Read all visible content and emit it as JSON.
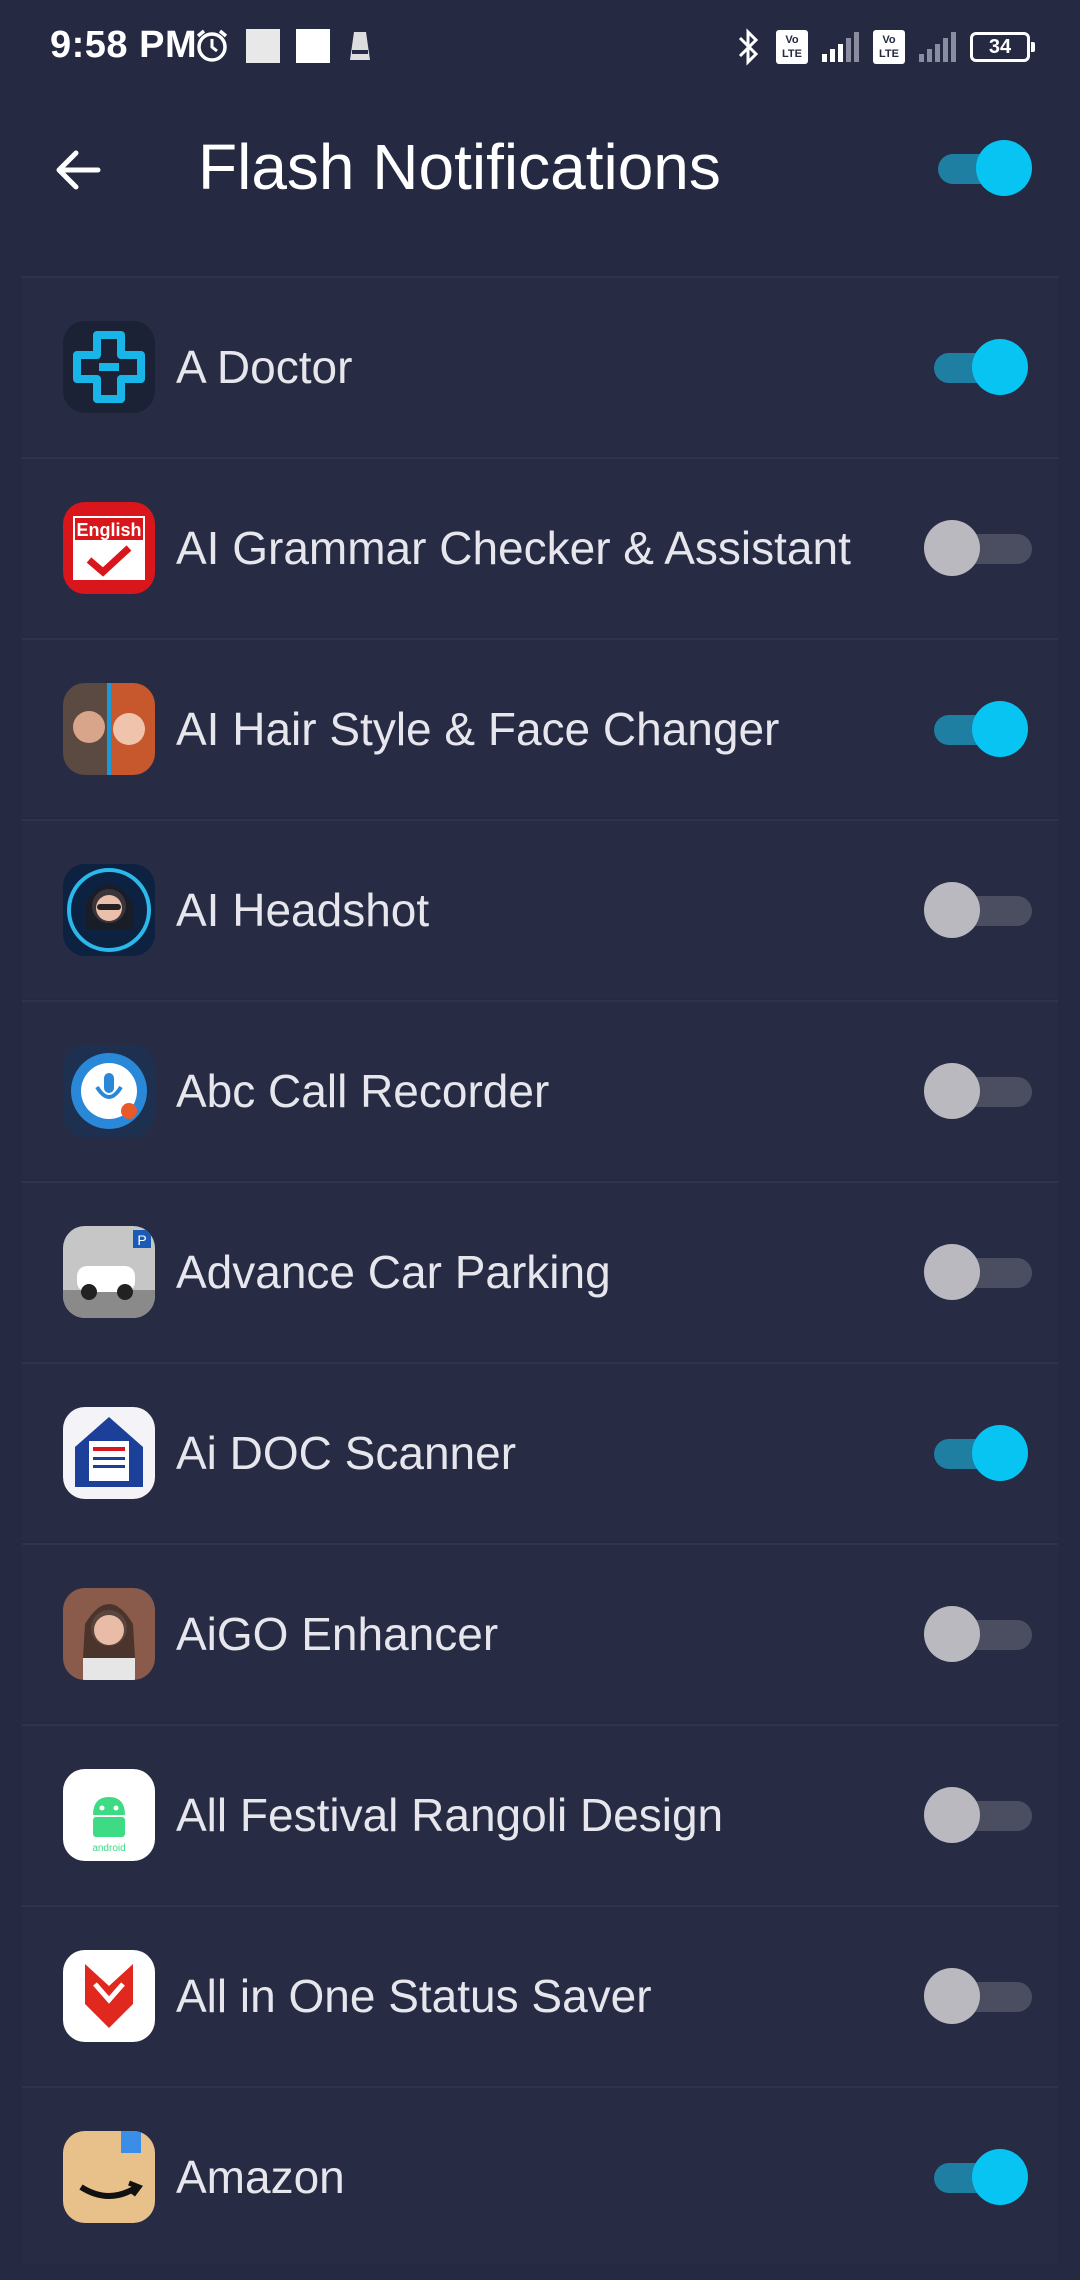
{
  "status_bar": {
    "time": "9:58 PM",
    "battery": "34",
    "volte1": "Vo LTE",
    "volte2": "Vo LTE"
  },
  "app_bar": {
    "title": "Flash Notifications",
    "master_toggle_on": true
  },
  "colors": {
    "background": "#252941",
    "toggle_on": "#08c4f2",
    "toggle_off": "#b9b9bf"
  },
  "apps": [
    {
      "name": "A Doctor",
      "icon": "medical-cross-icon",
      "enabled": true
    },
    {
      "name": "AI Grammar Checker & Assistant",
      "icon": "english-book-icon",
      "enabled": false
    },
    {
      "name": "AI Hair Style & Face Changer",
      "icon": "faces-icon",
      "enabled": true
    },
    {
      "name": "AI Headshot",
      "icon": "headshot-portrait-icon",
      "enabled": false
    },
    {
      "name": "Abc Call Recorder",
      "icon": "call-recorder-icon",
      "enabled": false
    },
    {
      "name": "Advance Car Parking",
      "icon": "car-parking-icon",
      "enabled": false
    },
    {
      "name": "Ai DOC Scanner",
      "icon": "doc-scanner-icon",
      "enabled": true
    },
    {
      "name": "AiGO Enhancer",
      "icon": "portrait-enhancer-icon",
      "enabled": false
    },
    {
      "name": "All Festival Rangoli Design",
      "icon": "android-icon",
      "enabled": false
    },
    {
      "name": "All in One Status Saver",
      "icon": "status-saver-icon",
      "enabled": false
    },
    {
      "name": "Amazon",
      "icon": "amazon-box-icon",
      "enabled": true
    }
  ]
}
